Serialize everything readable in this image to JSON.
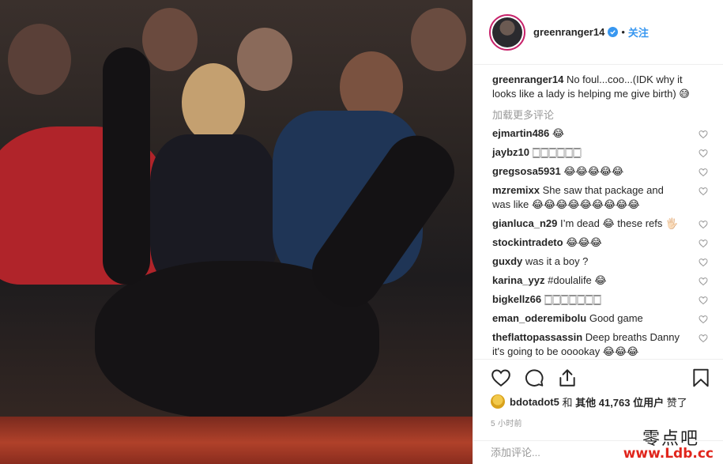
{
  "post": {
    "username": "greenranger14",
    "follow_label": "关注",
    "dot": "•"
  },
  "caption": {
    "username": "greenranger14",
    "text": "No foul...coo...(IDK why it looks like a lady is helping me give birth) 😅"
  },
  "load_more": "加载更多评论",
  "comments": [
    {
      "user": "ejmartin486",
      "text": "😂"
    },
    {
      "user": "jaybz10",
      "text": "🀆🀆🀆🀆🀆🀆"
    },
    {
      "user": "gregsosa5931",
      "text": "😂😂😂😂😂"
    },
    {
      "user": "mzremixx",
      "text": "She saw that package and was like 😂😂😂😂😂😂😂😂😂"
    },
    {
      "user": "gianluca_n29",
      "text": "I’m dead 😂 these refs 🖐🏻"
    },
    {
      "user": "stockintradeto",
      "text": "😂😂😂"
    },
    {
      "user": "guxdy",
      "text": "was it a boy ?"
    },
    {
      "user": "karina_yyz",
      "text": "#doulalife 😂"
    },
    {
      "user": "bigkellz66",
      "text": "🀆🀆🀆🀆🀆🀆🀆"
    },
    {
      "user": "eman_oderemibolu",
      "text": "Good game"
    },
    {
      "user": "theflattopassassin",
      "text": "Deep breaths Danny it's going to be ooookay 😂😂😂"
    }
  ],
  "likes": {
    "user": "bdotadot5",
    "and": "和",
    "others_prefix": "其他",
    "count": "41,763",
    "others_suffix": "位用户",
    "liked": "赞了"
  },
  "time_ago": "5 小时前",
  "add_comment_placeholder": "添加评论...",
  "watermark": {
    "cn": "零点吧",
    "url": "www.Ldb.cc"
  },
  "icons": {
    "like": "heart-icon",
    "comment": "comment-icon",
    "share": "share-icon",
    "save": "bookmark-icon",
    "verified": "verified-badge-icon"
  },
  "colors": {
    "accent": "#3897f0",
    "muted": "#999999",
    "text": "#262626",
    "watermark_url": "#e0251c"
  }
}
